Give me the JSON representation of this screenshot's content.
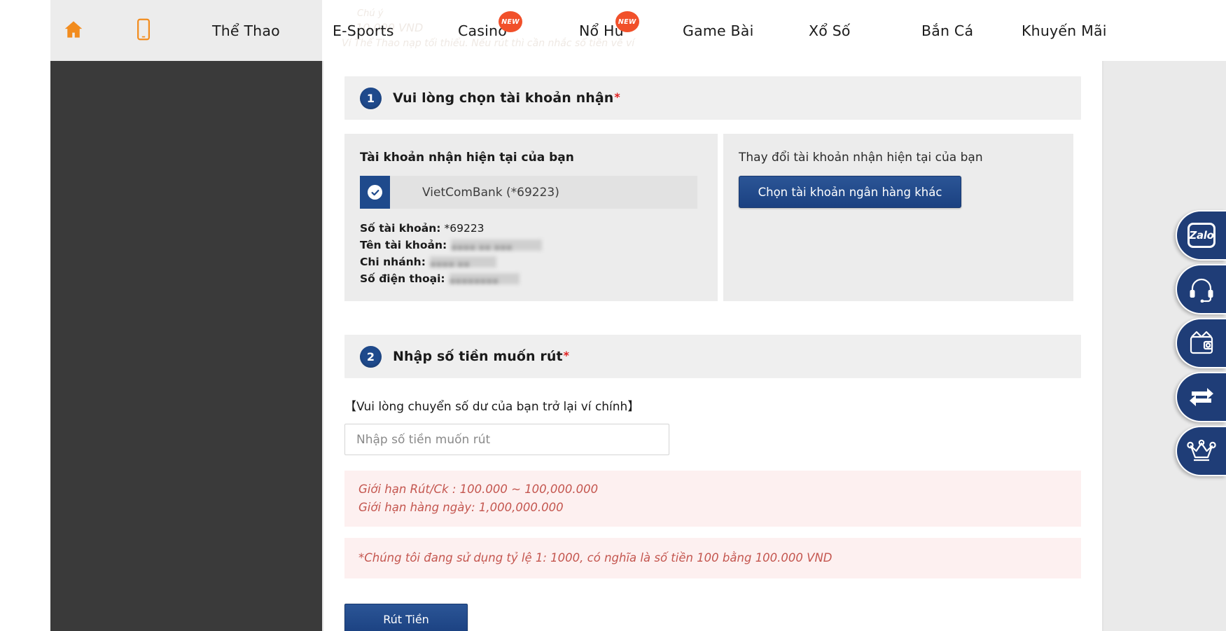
{
  "nav": {
    "items": [
      {
        "label": "home-icon",
        "type": "icon",
        "name": "home"
      },
      {
        "label": "mobile-icon",
        "type": "icon",
        "name": "mobile"
      },
      {
        "label": "Thể Thao",
        "badge": ""
      },
      {
        "label": "E-Sports",
        "badge": ""
      },
      {
        "label": "Casino",
        "badge": "NEW"
      },
      {
        "label": "Nổ Hũ",
        "badge": "NEW"
      },
      {
        "label": "Game Bài",
        "badge": ""
      },
      {
        "label": "Xổ Số",
        "badge": ""
      },
      {
        "label": "Bắn Cá",
        "badge": ""
      },
      {
        "label": "Khuyến Mãi",
        "badge": ""
      }
    ],
    "badge_text": "NEW",
    "ghost": {
      "line1": "Chú ý",
      "line2": "10.000 VND",
      "line3": "Ví Thể Thao nạp tối thiểu. Nếu rút thì cần nhắc số tiền về ví"
    }
  },
  "step1": {
    "number": "1",
    "title": "Vui lòng chọn tài khoản nhận",
    "required_mark": "*",
    "left_panel": {
      "title": "Tài khoản nhận hiện tại của bạn",
      "bank_label": "VietComBank (*69223)",
      "selected": true,
      "details": [
        {
          "label": "Số tài khoản:",
          "value": "*69223",
          "redacted": false
        },
        {
          "label": "Tên tài khoản:",
          "value": "",
          "redacted": true,
          "width": "red-w1"
        },
        {
          "label": "Chi nhánh:",
          "value": "",
          "redacted": true,
          "width": "red-w2"
        },
        {
          "label": "Số điện thoại:",
          "value": "",
          "redacted": true,
          "width": "red-w3"
        }
      ]
    },
    "right_panel": {
      "title": "Thay đổi tài khoản nhận hiện tại của bạn",
      "button_label": "Chọn tài khoản ngân hàng khác"
    }
  },
  "step2": {
    "number": "2",
    "title": "Nhập số tiền muốn rút",
    "required_mark": "*",
    "hint": "【Vui lòng chuyển số dư của bạn trở lại ví chính】",
    "amount_placeholder": "Nhập số tiền muốn rút",
    "amount_value": "",
    "notice_1_line1": "Giới hạn Rút/Ck : 100.000 ~ 100,000.000",
    "notice_1_line2": "Giới hạn hàng ngày: 1,000,000.000",
    "notice_2": "*Chúng tôi đang sử dụng tỷ lệ 1: 1000, có nghĩa là số tiền 100 bằng 100.000 VND",
    "submit_label": "Rút Tiền"
  },
  "float_widget": {
    "items": [
      {
        "name": "zalo-icon",
        "label": "Zalo"
      },
      {
        "name": "headset-icon",
        "label": ""
      },
      {
        "name": "wallet-icon",
        "label": ""
      },
      {
        "name": "transfer-icon",
        "label": ""
      },
      {
        "name": "crown-icon",
        "label": ""
      }
    ]
  },
  "colors": {
    "brand_blue": "#1f4a8c",
    "accent_orange": "#f28c1e",
    "badge_red": "#f1502a",
    "notice_red": "#c4564f",
    "notice_bg": "#fdf0f0",
    "panel_grey": "#ececec",
    "rail_dark": "#3a3a3a"
  }
}
